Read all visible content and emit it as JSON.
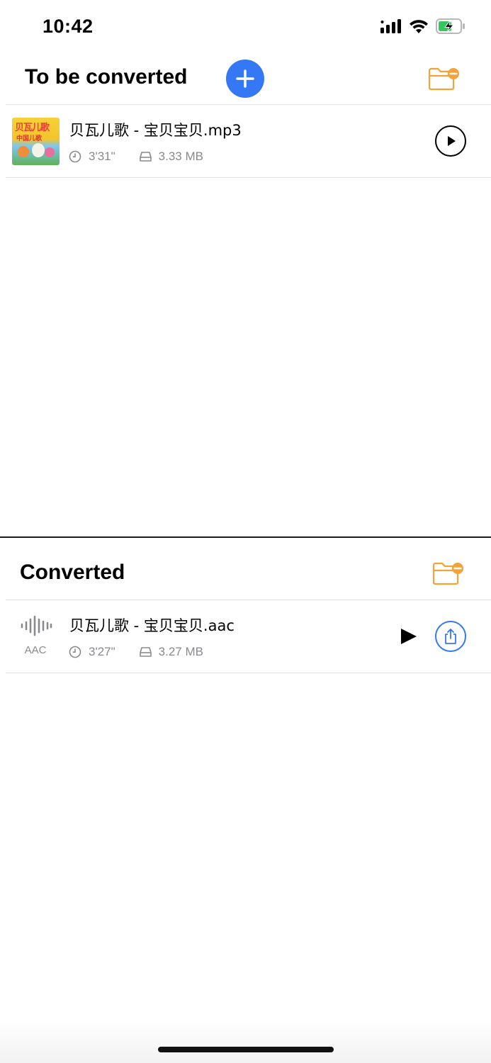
{
  "status_bar": {
    "time": "10:42"
  },
  "to_convert": {
    "title": "To be converted",
    "item": {
      "name": "贝瓦儿歌 - 宝贝宝贝.mp3",
      "duration": "3'31\"",
      "size": "3.33 MB",
      "thumb_text_top": "贝瓦儿歌",
      "thumb_text_bottom": "中国儿歌"
    }
  },
  "converted": {
    "title": "Converted",
    "item": {
      "format": "AAC",
      "name": "贝瓦儿歌 - 宝贝宝贝.aac",
      "duration": "3'27\"",
      "size": "3.27 MB"
    }
  },
  "colors": {
    "accent_blue": "#3478f6",
    "folder_orange": "#f2a33a",
    "meta_gray": "#8a8a8e"
  },
  "icons": {
    "signal": "signal-icon",
    "wifi": "wifi-icon",
    "battery": "battery-charging-icon",
    "add": "plus-icon",
    "folder_remove": "folder-minus-icon",
    "play": "play-icon",
    "share": "share-icon",
    "clock": "clock-icon",
    "drive": "drive-icon",
    "waveform": "waveform-icon"
  }
}
